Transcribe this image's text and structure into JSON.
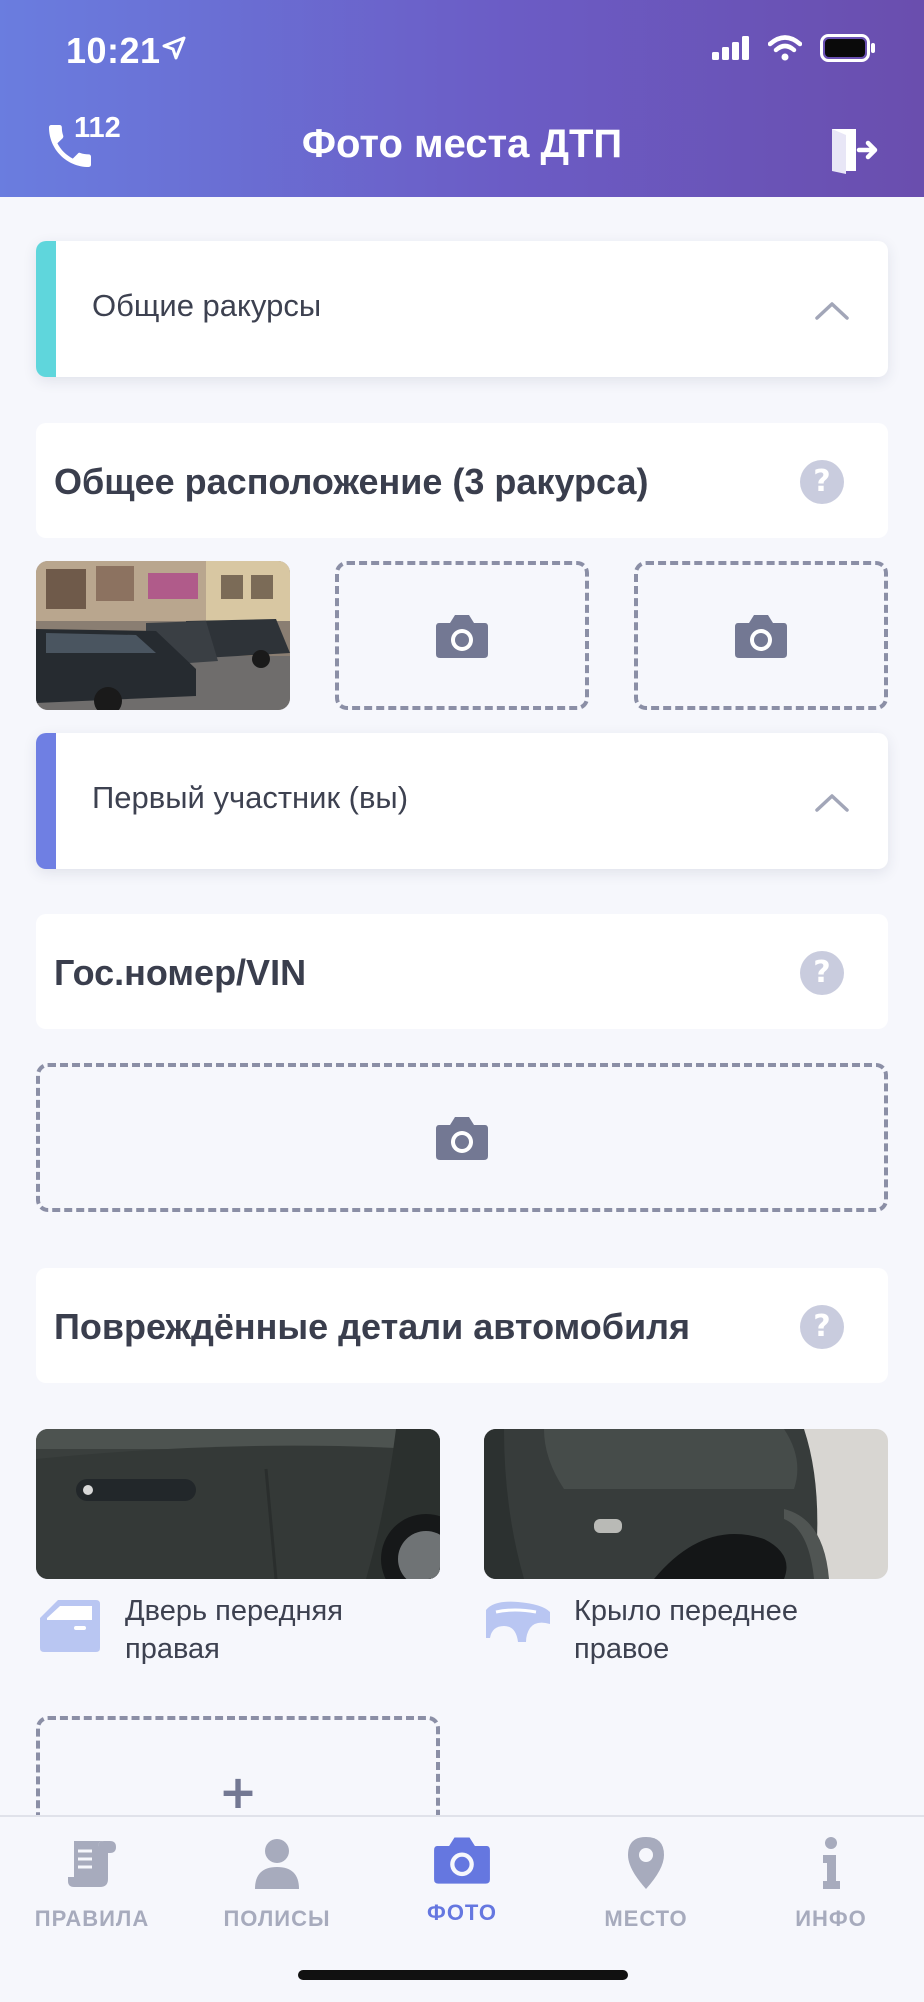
{
  "status_bar": {
    "time": "10:21"
  },
  "header": {
    "title": "Фото места ДТП",
    "emergency_number": "112"
  },
  "sections": {
    "general_angles": {
      "label": "Общие ракурсы",
      "accent": "#5fd6dc"
    },
    "first_participant": {
      "label": "Первый участник (вы)",
      "accent": "#6f7fe3"
    }
  },
  "general_location": {
    "title": "Общее расположение (3 ракурса)",
    "help": "?"
  },
  "plate_vin": {
    "title": "Гос.номер/VIN",
    "help": "?"
  },
  "damaged_parts": {
    "title": "Повреждённые детали автомобиля",
    "help": "?",
    "items": [
      {
        "line1": "Дверь передняя",
        "line2": "правая",
        "icon": "car-door-icon"
      },
      {
        "line1": "Крыло переднее",
        "line2": "правое",
        "icon": "car-fender-icon"
      }
    ],
    "add_label": "+"
  },
  "tabs": [
    {
      "label": "ПРАВИЛА",
      "icon": "scroll-icon"
    },
    {
      "label": "ПОЛИСЫ",
      "icon": "person-icon"
    },
    {
      "label": "ФОТО",
      "icon": "camera-icon",
      "active": true
    },
    {
      "label": "МЕСТО",
      "icon": "location-pin-icon"
    },
    {
      "label": "ИНФО",
      "icon": "info-icon"
    }
  ],
  "colors": {
    "header_start": "#6a7ddf",
    "header_end": "#6a4eae",
    "active_tab": "#6577e0",
    "inactive_tab": "#a7abbd"
  }
}
